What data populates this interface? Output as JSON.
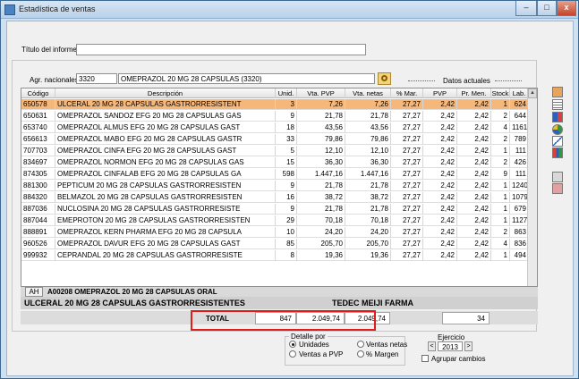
{
  "window": {
    "title": "Estadística de ventas",
    "min": "–",
    "max": "□",
    "close": "x"
  },
  "report": {
    "title_label": "Título del informe",
    "title_value": ""
  },
  "agr": {
    "label": "Agr. nacionales",
    "code": "3320",
    "name": "OMEPRAZOL 20 MG 28 CAPSULAS (3320)",
    "datos_label": "Datos actuales"
  },
  "grid": {
    "headers": [
      "Código",
      "Descripción",
      "Unid.",
      "Vta. PVP",
      "Vta. netas",
      "% Mar.",
      "PVP",
      "Pr. Men.",
      "Stock",
      "Lab."
    ],
    "rows": [
      [
        "650578",
        "ULCERAL 20 MG 28 CAPSULAS GASTRORRESISTENT",
        "3",
        "7,26",
        "7,26",
        "27,27",
        "2,42",
        "2,42",
        "1",
        "624"
      ],
      [
        "650631",
        "OMEPRAZOL SANDOZ EFG 20 MG 28 CAPSULAS GAS",
        "9",
        "21,78",
        "21,78",
        "27,27",
        "2,42",
        "2,42",
        "2",
        "644"
      ],
      [
        "653740",
        "OMEPRAZOL ALMUS EFG 20 MG 28 CAPSULAS GAST",
        "18",
        "43,56",
        "43,56",
        "27,27",
        "2,42",
        "2,42",
        "4",
        "1161"
      ],
      [
        "656613",
        "OMEPRAZOL MABO EFG 20 MG 28 CAPSULAS GASTR",
        "33",
        "79,86",
        "79,86",
        "27,27",
        "2,42",
        "2,42",
        "2",
        "789"
      ],
      [
        "707703",
        "OMEPRAZOL CINFA EFG 20 MG 28 CAPSULAS GAST",
        "5",
        "12,10",
        "12,10",
        "27,27",
        "2,42",
        "2,42",
        "1",
        "111"
      ],
      [
        "834697",
        "OMEPRAZOL NORMON EFG 20 MG 28 CAPSULAS GAS",
        "15",
        "36,30",
        "36,30",
        "27,27",
        "2,42",
        "2,42",
        "2",
        "426"
      ],
      [
        "874305",
        "OMEPRAZOL CINFALAB EFG 20 MG 28 CAPSULAS GA",
        "598",
        "1.447,16",
        "1.447,16",
        "27,27",
        "2,42",
        "2,42",
        "9",
        "111"
      ],
      [
        "881300",
        "PEPTICUM 20 MG 28 CAPSULAS GASTRORRESISTEN",
        "9",
        "21,78",
        "21,78",
        "27,27",
        "2,42",
        "2,42",
        "1",
        "1240"
      ],
      [
        "884320",
        "BELMAZOL 20 MG 28 CAPSULAS GASTRORRESISTEN",
        "16",
        "38,72",
        "38,72",
        "27,27",
        "2,42",
        "2,42",
        "1",
        "1079"
      ],
      [
        "887036",
        "NUCLOSINA 20 MG 28 CAPSULAS GASTRORRESISTE",
        "9",
        "21,78",
        "21,78",
        "27,27",
        "2,42",
        "2,42",
        "1",
        "679"
      ],
      [
        "887044",
        "EMEPROTON 20 MG 28 CAPSULAS GASTRORRESISTEN",
        "29",
        "70,18",
        "70,18",
        "27,27",
        "2,42",
        "2,42",
        "1",
        "1127"
      ],
      [
        "888891",
        "OMEPRAZOL KERN PHARMA EFG 20 MG 28 CAPSULA",
        "10",
        "24,20",
        "24,20",
        "27,27",
        "2,42",
        "2,42",
        "2",
        "863"
      ],
      [
        "960526",
        "OMEPRAZOL DAVUR EFG 20 MG 28 CAPSULAS GAST",
        "85",
        "205,70",
        "205,70",
        "27,27",
        "2,42",
        "2,42",
        "4",
        "836"
      ],
      [
        "999932",
        "CEPRANDAL 20 MG 28 CAPSULAS GASTRORRESISTE",
        "8",
        "19,36",
        "19,36",
        "27,27",
        "2,42",
        "2,42",
        "1",
        "494"
      ]
    ]
  },
  "detail": {
    "ah_button": "AH",
    "ah_text": "A00208  OMEPRAZOL 20 MG 28 CAPSULAS ORAL",
    "product": "ULCERAL 20 MG 28 CAPSULAS GASTRORRESISTENTES",
    "lab": "TEDEC MEIJI FARMA"
  },
  "totals": {
    "label": "TOTAL",
    "units": "847",
    "vta_pvp": "2.049,74",
    "vta_netas": "2.049,74",
    "stock": "34"
  },
  "detalle": {
    "label": "Detalle por",
    "options": [
      "Unidades",
      "Ventas netas",
      "Ventas a PVP",
      "% Margen"
    ],
    "selected": "Unidades"
  },
  "ejercicio": {
    "label": "Ejercicio",
    "year": "2013",
    "prev": "<",
    "next": ">",
    "agrupar_label": "Agrupar cambios"
  },
  "colors": {
    "selected_row": "#f6b77a",
    "highlight_box": "#e21b1b"
  },
  "side_icons": [
    "print-icon",
    "table-icon",
    "bar-chart-icon",
    "pie-chart-icon",
    "line-chart-icon",
    "column-chart-icon",
    "export-icon",
    "settings-icon"
  ]
}
